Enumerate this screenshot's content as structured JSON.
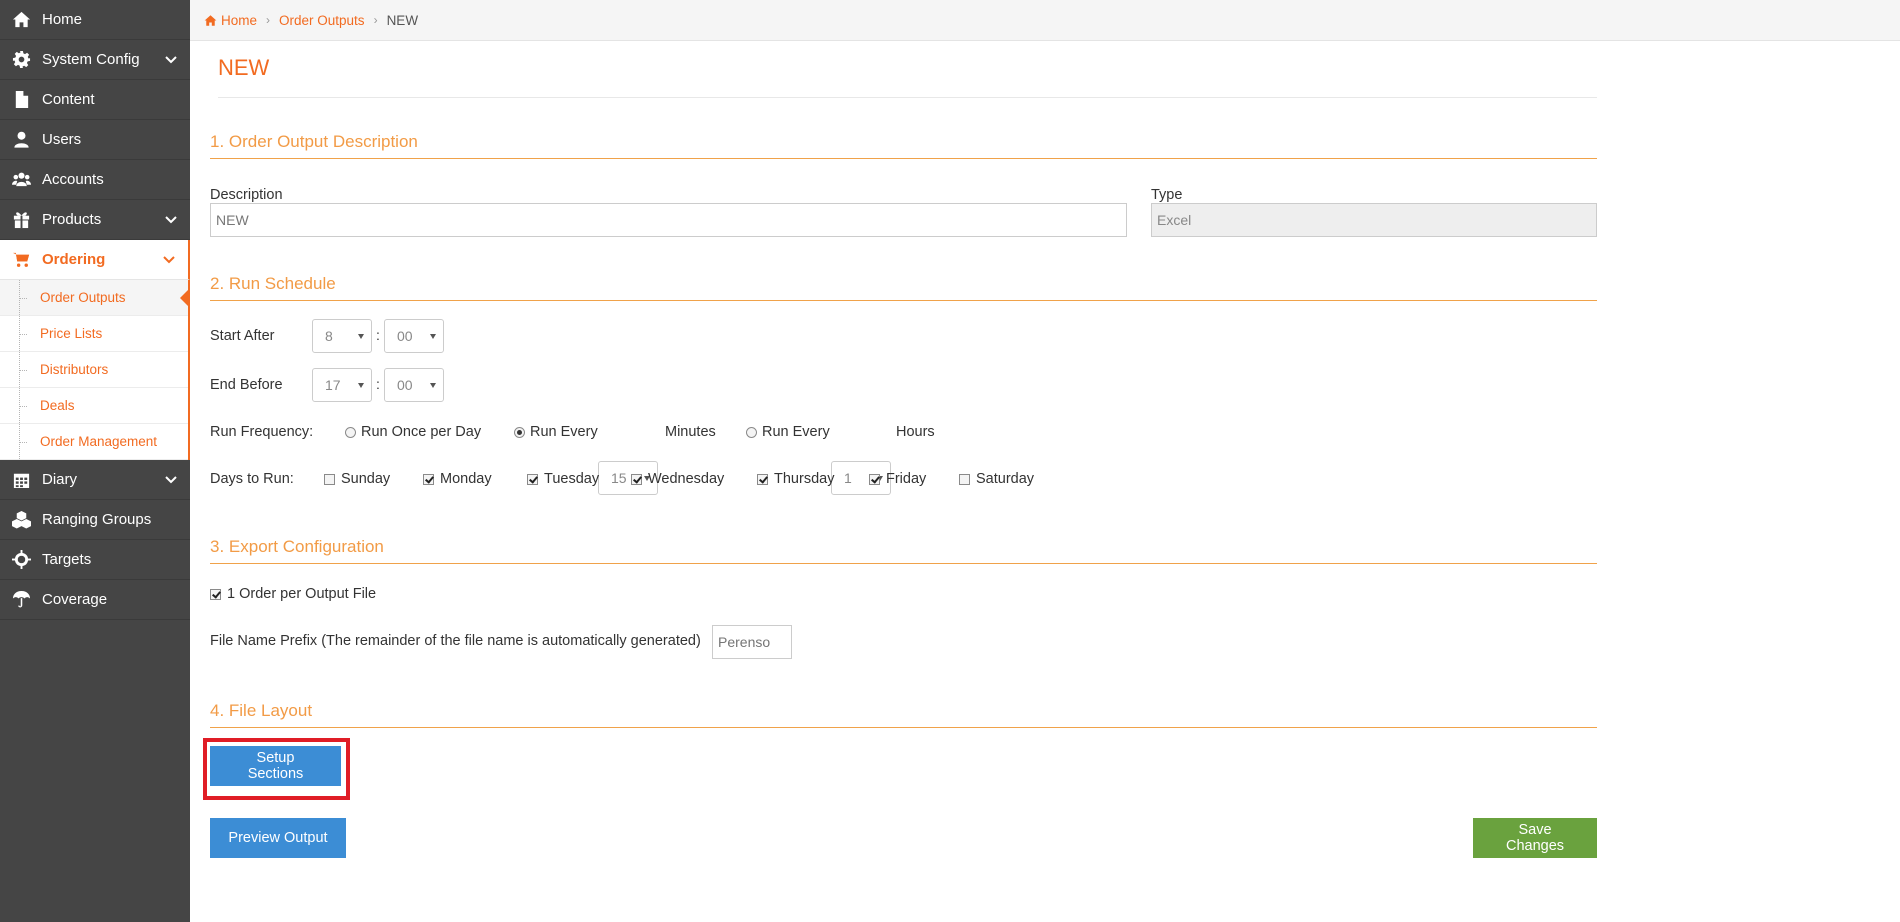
{
  "sidebar": {
    "items": [
      {
        "label": "Home",
        "icon": "home-icon"
      },
      {
        "label": "System Config",
        "icon": "gear-icon",
        "expandable": true
      },
      {
        "label": "Content",
        "icon": "document-icon"
      },
      {
        "label": "Users",
        "icon": "user-icon"
      },
      {
        "label": "Accounts",
        "icon": "users-group-icon"
      },
      {
        "label": "Products",
        "icon": "gift-icon",
        "expandable": true
      },
      {
        "label": "Ordering",
        "icon": "cart-icon",
        "expandable": true,
        "active": true
      },
      {
        "label": "Diary",
        "icon": "calendar-icon",
        "expandable": true
      },
      {
        "label": "Ranging Groups",
        "icon": "cubes-icon"
      },
      {
        "label": "Targets",
        "icon": "crosshair-icon"
      },
      {
        "label": "Coverage",
        "icon": "umbrella-icon"
      }
    ],
    "ordering_subitems": [
      {
        "label": "Order Outputs",
        "current": true
      },
      {
        "label": "Price Lists"
      },
      {
        "label": "Distributors"
      },
      {
        "label": "Deals"
      },
      {
        "label": "Order Management"
      }
    ]
  },
  "breadcrumb": {
    "home": "Home",
    "parent": "Order Outputs",
    "current": "NEW"
  },
  "page_title": "NEW",
  "section1": {
    "heading": "1. Order Output Description",
    "description_label": "Description",
    "description_value": "NEW",
    "type_label": "Type",
    "type_value": "Excel"
  },
  "section2": {
    "heading": "2. Run Schedule",
    "start_after_label": "Start After",
    "start_hour": "8",
    "start_minute": "00",
    "end_before_label": "End Before",
    "end_hour": "17",
    "end_minute": "00",
    "colon": ":",
    "run_frequency_label": "Run Frequency:",
    "run_once_label": "Run Once per Day",
    "run_every_label": "Run Every",
    "run_every_minutes_value": "15",
    "minutes_label": "Minutes",
    "run_every_hours_value": "1",
    "hours_label": "Hours",
    "selected_frequency": "minutes",
    "days_label": "Days to Run:",
    "days": [
      {
        "label": "Sunday",
        "checked": false
      },
      {
        "label": "Monday",
        "checked": true
      },
      {
        "label": "Tuesday",
        "checked": true
      },
      {
        "label": "Wednesday",
        "checked": true
      },
      {
        "label": "Thursday",
        "checked": true
      },
      {
        "label": "Friday",
        "checked": true
      },
      {
        "label": "Saturday",
        "checked": false
      }
    ]
  },
  "section3": {
    "heading": "3. Export Configuration",
    "one_order_label": "1 Order per Output File",
    "one_order_checked": true,
    "prefix_label": "File Name Prefix (The remainder of the file name is automatically generated)",
    "prefix_placeholder": "Perenso"
  },
  "section4": {
    "heading": "4. File Layout",
    "setup_sections_label": "Setup Sections"
  },
  "actions": {
    "preview_label": "Preview Output",
    "save_label": "Save Changes"
  },
  "colors": {
    "accent": "#f26b21",
    "section_heading": "#f29b46",
    "sidebar_bg": "#454545",
    "primary_button": "#3c8dd5",
    "success_button": "#6aa23e",
    "highlight": "#e01d26"
  }
}
